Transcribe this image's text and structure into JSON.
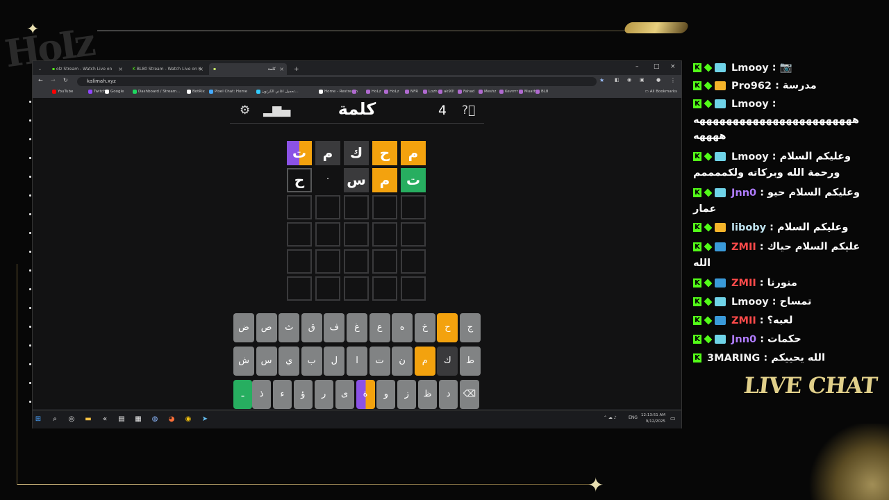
{
  "overlay": {
    "logo_text": "HoIz",
    "live_chat_label": "LIVE CHAT"
  },
  "browser": {
    "tabs": [
      {
        "label": "olz Stream - Watch Live on"
      },
      {
        "label": "BL80 Stream - Watch Live on K"
      },
      {
        "label": "كلمة"
      }
    ],
    "url": "kalimah.xyz",
    "bookmarks": [
      "YouTube",
      "Twitch",
      "Google",
      "Dashboard / Stream...",
      "BotRix",
      "Pixel Chat: Home",
      "تحميل اغاني الكرتون...",
      "Home - Restream",
      "",
      "HoLz",
      "HoLz",
      "NFR",
      "Lozh",
      "ak90!",
      "Fahad",
      "Meshz",
      "Kevrrrr",
      "Muath",
      "BL8"
    ],
    "all_bookmarks_label": "All Bookmarks"
  },
  "game": {
    "title": "كلمة",
    "streak": "4",
    "rows": [
      [
        {
          "l": "م",
          "s": "yellow"
        },
        {
          "l": "ح",
          "s": "yellow"
        },
        {
          "l": "ك",
          "s": "gray"
        },
        {
          "l": "م",
          "s": "gray"
        },
        {
          "l": "ت",
          "s": "purple"
        }
      ],
      [
        {
          "l": "ت",
          "s": "green"
        },
        {
          "l": "م",
          "s": "yellow"
        },
        {
          "l": "س",
          "s": "gray"
        },
        {
          "l": "·",
          "s": "empty"
        },
        {
          "l": "ح",
          "s": "filled"
        }
      ]
    ],
    "keyboard_row1": [
      "ج",
      "ح",
      "خ",
      "ه",
      "ع",
      "غ",
      "ف",
      "ق",
      "ث",
      "ص",
      "ض"
    ],
    "keyboard_row2": [
      "ط",
      "ك",
      "م",
      "ن",
      "ت",
      "ا",
      "ل",
      "ب",
      "ي",
      "س",
      "ش"
    ],
    "keyboard_row3": [
      "⌫",
      "د",
      "ظ",
      "ز",
      "و",
      "ة",
      "ى",
      "ر",
      "ؤ",
      "ء",
      "ذ",
      "ـ"
    ]
  },
  "taskbar": {
    "time": "12:13:51 AM",
    "date": "9/12/2025",
    "lang": "ENG"
  },
  "chat": [
    {
      "user": "Lmooy",
      "color": "#f0f0f0",
      "badge": "plain",
      "text": "📷"
    },
    {
      "user": "Pro962",
      "color": "#f0f0f0",
      "badge": "crown",
      "text": "مدرسة"
    },
    {
      "user": "Lmooy",
      "color": "#f0f0f0",
      "badge": "plain",
      "text": "ههههههههههههههههههههههههه ههههه"
    },
    {
      "user": "Lmooy",
      "color": "#f0f0f0",
      "badge": "plain",
      "text": "وعليكم السلام ورحمة الله وبركاته ولكممممم"
    },
    {
      "user": "Jnn0",
      "color": "#b07cff",
      "badge": "plain",
      "text": "وعليكم السلام حيو عمار"
    },
    {
      "user": "liboby",
      "color": "#bfe3ef",
      "badge": "crown",
      "text": "وعليكم السلام"
    },
    {
      "user": "ZMII",
      "color": "#ff4a4a",
      "badge": "arrow",
      "text": "عليكم السلام حياك الله"
    },
    {
      "user": "ZMII",
      "color": "#ff4a4a",
      "badge": "arrow",
      "text": "منورنا"
    },
    {
      "user": "Lmooy",
      "color": "#f0f0f0",
      "badge": "plain",
      "text": "تمساح"
    },
    {
      "user": "ZMII",
      "color": "#ff4a4a",
      "badge": "arrow",
      "text": "لعبه؟"
    },
    {
      "user": "Jnn0",
      "color": "#b07cff",
      "badge": "plain",
      "text": "حكمات"
    },
    {
      "user": "3MARING",
      "color": "#f0f0f0",
      "badge": "none",
      "text": "الله يحييكم"
    }
  ]
}
